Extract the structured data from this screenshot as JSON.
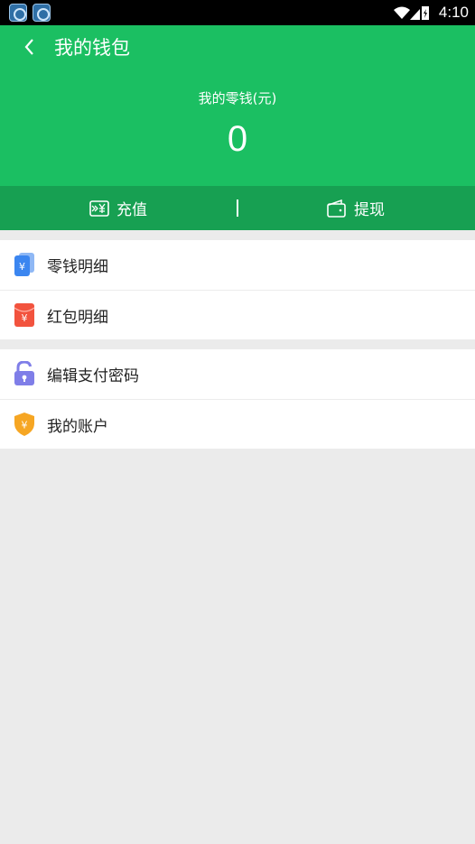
{
  "status_bar": {
    "time": "4:10"
  },
  "header": {
    "title": "我的钱包",
    "balance_label": "我的零钱(元)",
    "balance": "0"
  },
  "actions": {
    "recharge": "充值",
    "withdraw": "提现"
  },
  "menu_group1": [
    {
      "label": "零钱明细"
    },
    {
      "label": "红包明细"
    }
  ],
  "menu_group2": [
    {
      "label": "编辑支付密码"
    },
    {
      "label": "我的账户"
    }
  ],
  "colors": {
    "header_green": "#1bbf62",
    "action_green": "#17a052",
    "background": "#ebebeb"
  }
}
